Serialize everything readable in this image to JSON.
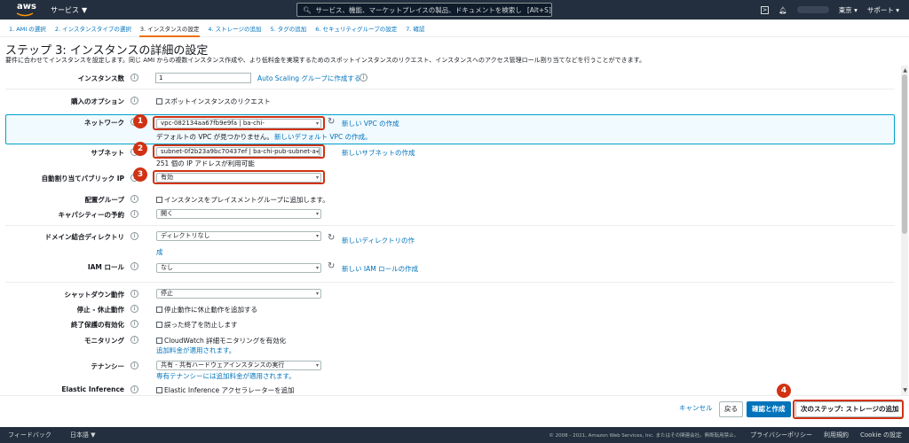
{
  "nav": {
    "logo": "aws",
    "services": "サービス",
    "search_placeholder": "サービス、機能、マーケットプレイスの製品、ドキュメントを検索し",
    "search_shortcut": "[Alt+S]",
    "region": "東京",
    "support": "サポート"
  },
  "tabs": [
    "1. AMI の選択",
    "2. インスタンスタイプの選択",
    "3. インスタンスの設定",
    "4. ストレージの追加",
    "5. タグの追加",
    "6. セキュリティグループの設定",
    "7. 確認"
  ],
  "page": {
    "title": "ステップ 3: インスタンスの詳細の設定",
    "desc": "要件に合わせてインスタンスを設定します。同じ AMI からの複数インスタンス作成や、より低料金を実現するためのスポットインスタンスのリクエスト、インスタンスへのアクセス管理ロール割り当てなどを行うことができます。"
  },
  "form": {
    "count_label": "インスタンス数",
    "count_value": "1",
    "asg_link": "Auto Scaling グループに作成する",
    "purchase_label": "購入のオプション",
    "spot_label": "スポットインスタンスのリクエスト",
    "network_label": "ネットワーク",
    "network_value": "vpc-082134aa67fb9e9fa | ba-chi-",
    "new_vpc": "新しい VPC の作成",
    "network_note": "デフォルトの VPC が見つかりません。",
    "new_default_vpc": "新しいデフォルト VPC の作成。",
    "subnet_label": "サブネット",
    "subnet_value": "subnet-0f2b23a9bc70437ef | ba-chi-pub-subnet-a | a",
    "new_subnet": "新しいサブネットの作成",
    "subnet_note": "251 個の IP アドレスが利用可能",
    "public_ip_label": "自動割り当てパブリック IP",
    "public_ip_value": "有効",
    "placement_label": "配置グループ",
    "placement_chk": "インスタンスをプレイスメントグループに追加します。",
    "capacity_label": "キャパシティーの予約",
    "capacity_value": "開く",
    "domain_label": "ドメイン結合ディレクトリ",
    "domain_value": "ディレクトリなし",
    "new_directory": "新しいディレクトリの作",
    "new_directory_2": "成",
    "iam_label": "IAM ロール",
    "iam_value": "なし",
    "new_iam": "新しい IAM ロールの作成",
    "shutdown_label": "シャットダウン動作",
    "shutdown_value": "停止",
    "stop_hib_label": "停止 - 休止動作",
    "stop_hib_chk": "停止動作に休止動作を追加する",
    "term_label": "終了保護の有効化",
    "term_chk": "誤った終了を防止します",
    "monitor_label": "モニタリング",
    "monitor_chk": "CloudWatch 詳細モニタリングを有効化",
    "monitor_note": "追加料金が適用されます。",
    "tenancy_label": "テナンシー",
    "tenancy_value": "共有 - 共有ハードウェアインスタンスの実行",
    "tenancy_note": "専有テナンシーには追加料金が適用されます。",
    "ei_label": "Elastic Inference",
    "ei_chk": "Elastic Inference アクセラレーターを追加"
  },
  "badges": [
    "1",
    "2",
    "3",
    "4"
  ],
  "actions": {
    "cancel": "キャンセル",
    "back": "戻る",
    "review": "確認と作成",
    "next": "次のステップ: ストレージの追加"
  },
  "footer": {
    "feedback": "フィードバック",
    "lang": "日本語",
    "copyright": "© 2008 - 2021, Amazon Web Services, Inc. またはその関連会社。無断転用禁止。",
    "privacy": "プライバシーポリシー",
    "terms": "利用規約",
    "cookies": "Cookie の設定"
  },
  "icons": {
    "info": "i",
    "refresh": "↻",
    "caret": "▾"
  }
}
